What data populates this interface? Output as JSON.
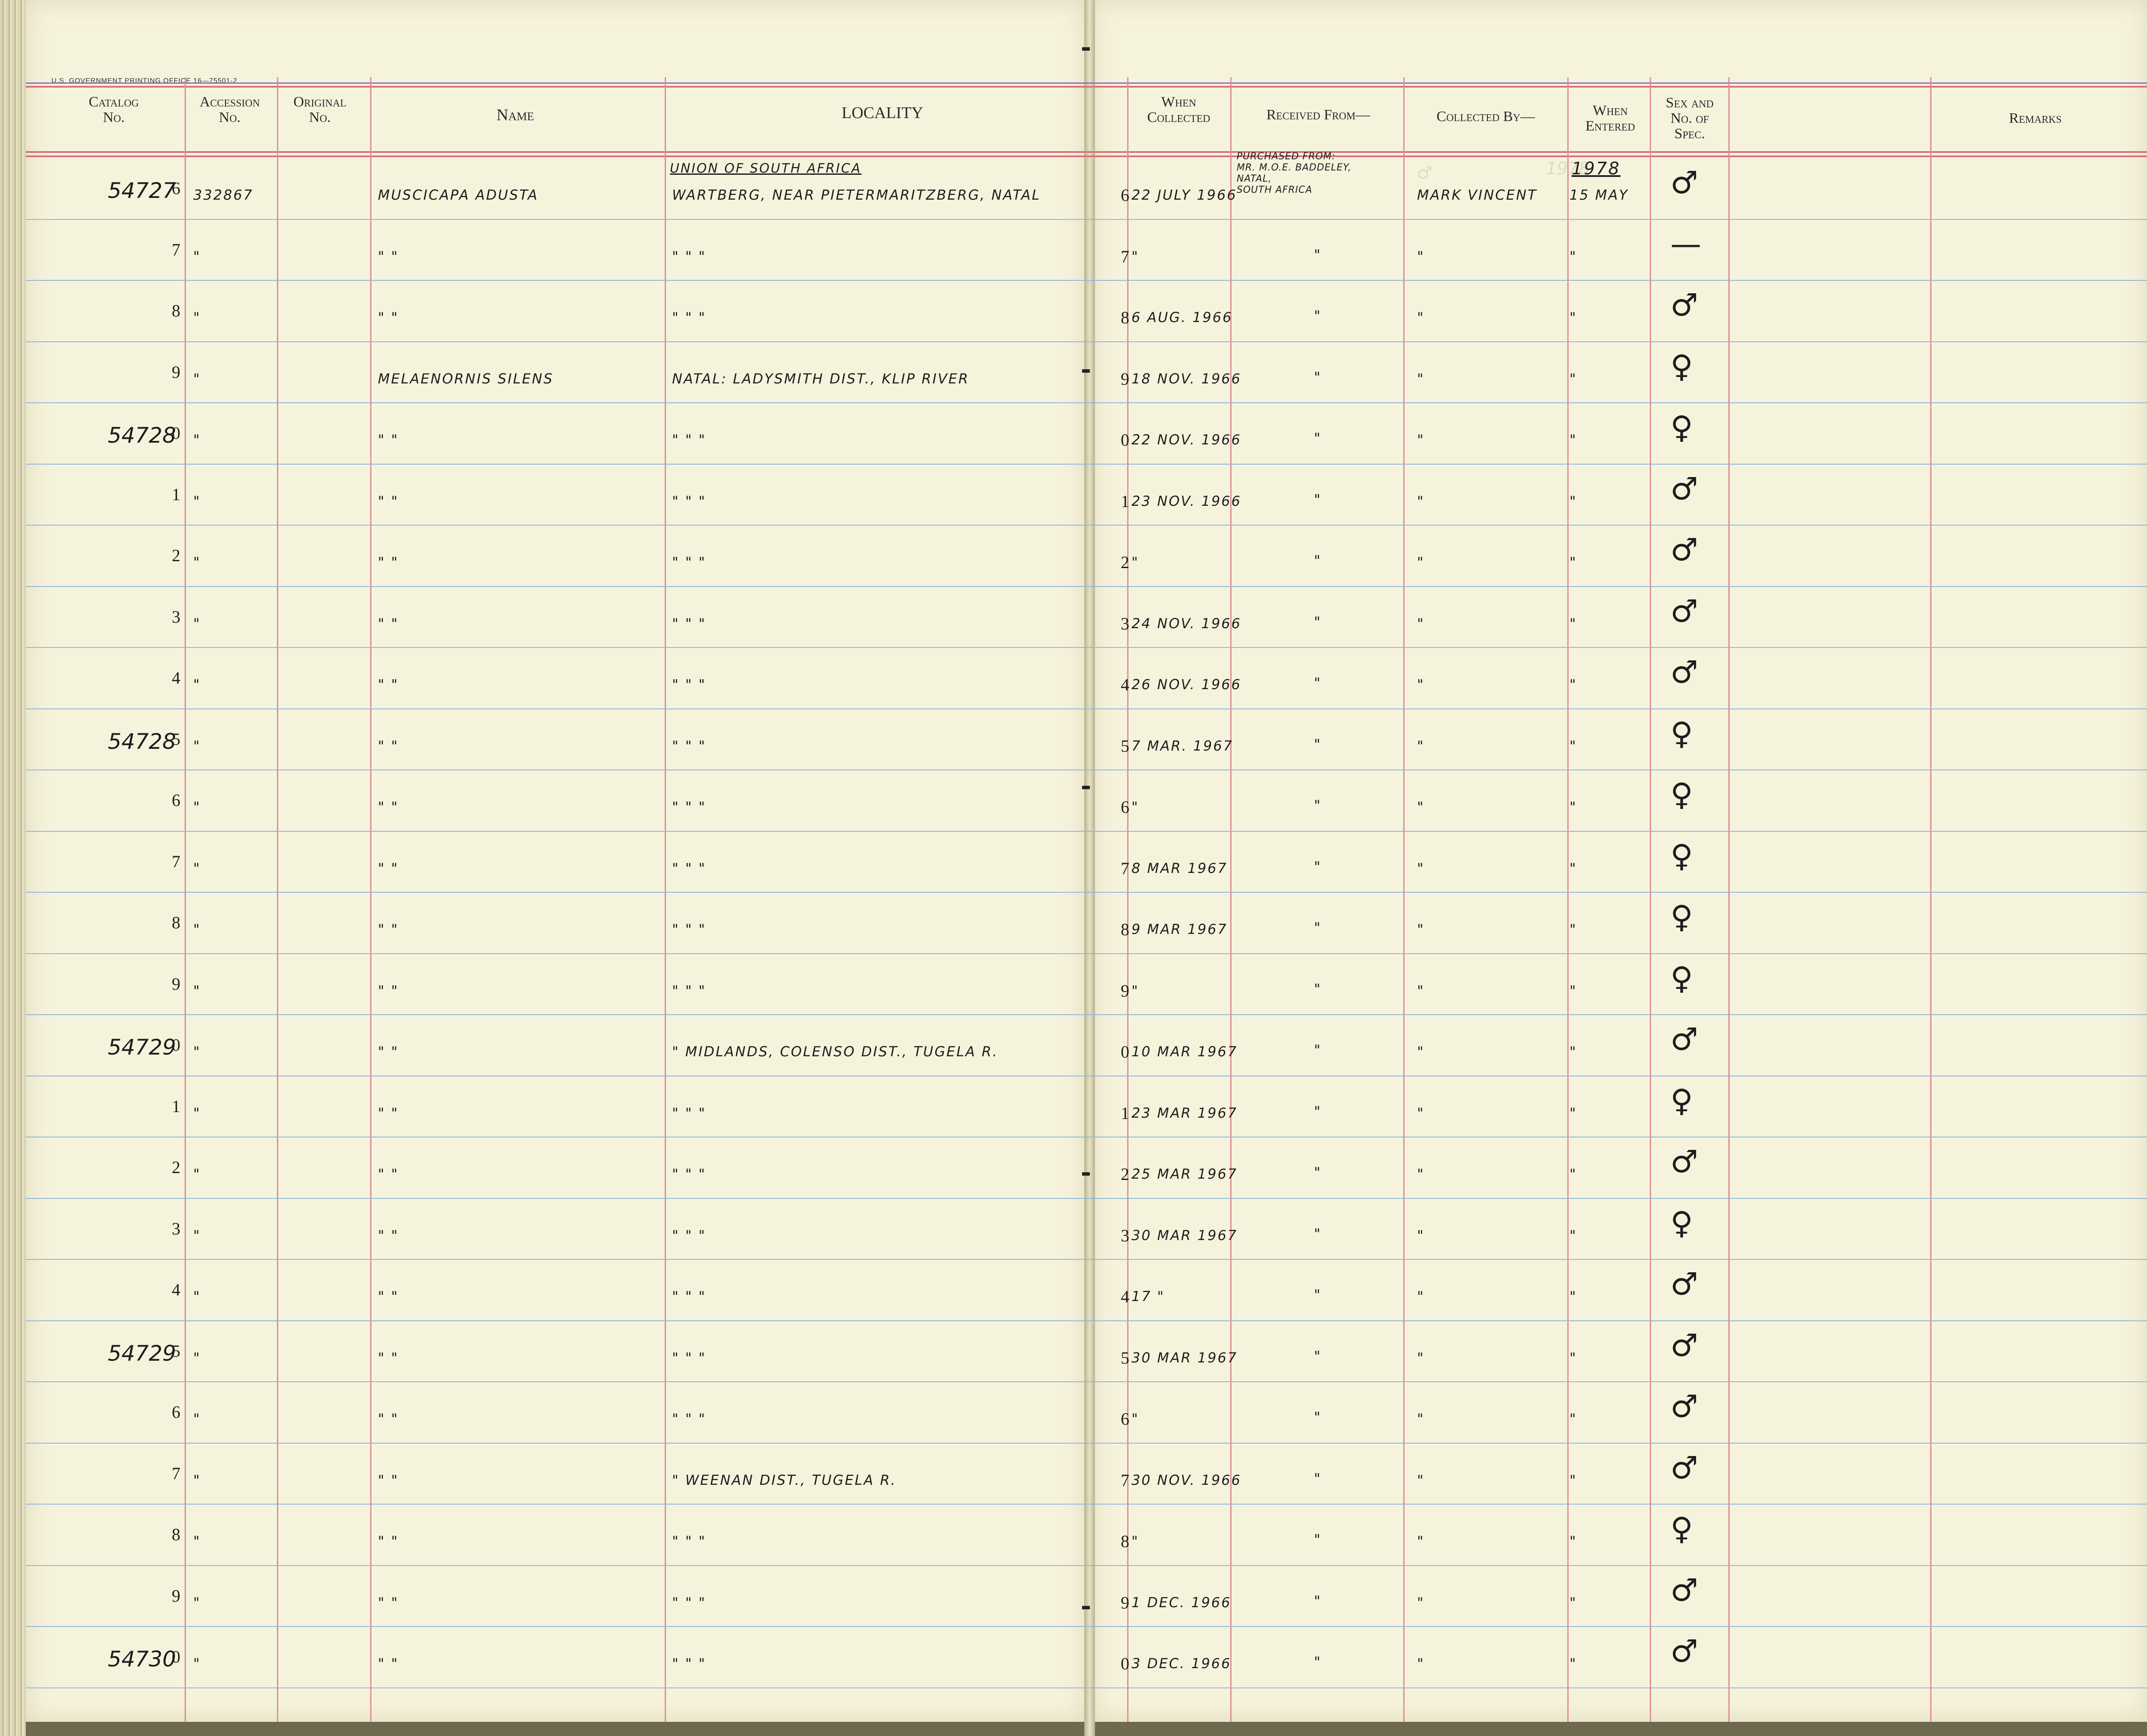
{
  "printer_line": "U.S. GOVERNMENT PRINTING OFFICE   16—75501-2",
  "headers": {
    "catalog": "Catalog\nNo.",
    "accession": "Accession\nNo.",
    "original": "Original\nNo.",
    "name": "Name",
    "locality": "LOCALITY",
    "when_collected": "When\nCollected",
    "received_from": "Received From—",
    "collected_by": "Collected By—",
    "when_entered": "When\nEntered",
    "sex": "Sex and\nNo. of\nSpec.",
    "remarks": "Remarks"
  },
  "header_notes": {
    "locality_heading": "UNION OF SOUTH AFRICA",
    "entered_year": "1978",
    "received_from_note": "PURCHASED FROM:\nMR. M.O.E. BADDELEY,\nNATAL,\nSOUTH AFRICA"
  },
  "rows": [
    {
      "catalog": "54727",
      "digit": "6",
      "accession": "332867",
      "name": "MUSCICAPA ADUSTA",
      "locality": "WARTBERG, NEAR PIETERMARITZBERG, NATAL",
      "cdigit": "6",
      "collected": "22 JULY 1966",
      "received": "",
      "collected_by": "MARK VINCENT",
      "entered": "15 MAY",
      "sex": "♂"
    },
    {
      "catalog": "",
      "digit": "7",
      "accession": "\"",
      "name": "\"          \"",
      "locality": "\"               \"               \"",
      "cdigit": "7",
      "collected": "\"",
      "received": "\"",
      "collected_by": "\"",
      "entered": "\"",
      "sex": "—"
    },
    {
      "catalog": "",
      "digit": "8",
      "accession": "\"",
      "name": "\"          \"",
      "locality": "\"               \"               \"",
      "cdigit": "8",
      "collected": "6 AUG. 1966",
      "received": "\"",
      "collected_by": "\"",
      "entered": "\"",
      "sex": "♂"
    },
    {
      "catalog": "",
      "digit": "9",
      "accession": "\"",
      "name": "MELAENORNIS SILENS",
      "locality": "NATAL: LADYSMITH DIST., KLIP RIVER",
      "cdigit": "9",
      "collected": "18 NOV. 1966",
      "received": "\"",
      "collected_by": "\"",
      "entered": "\"",
      "sex": "♀"
    },
    {
      "catalog": "54728",
      "digit": "0",
      "accession": "\"",
      "name": "\"          \"",
      "locality": "\"               \"               \"",
      "cdigit": "0",
      "collected": "22 NOV. 1966",
      "received": "\"",
      "collected_by": "\"",
      "entered": "\"",
      "sex": "♀"
    },
    {
      "catalog": "",
      "digit": "1",
      "accession": "\"",
      "name": "\"          \"",
      "locality": "\"               \"               \"",
      "cdigit": "1",
      "collected": "23 NOV. 1966",
      "received": "\"",
      "collected_by": "\"",
      "entered": "\"",
      "sex": "♂"
    },
    {
      "catalog": "",
      "digit": "2",
      "accession": "\"",
      "name": "\"          \"",
      "locality": "\"               \"               \"",
      "cdigit": "2",
      "collected": "\"",
      "received": "\"",
      "collected_by": "\"",
      "entered": "\"",
      "sex": "♂"
    },
    {
      "catalog": "",
      "digit": "3",
      "accession": "\"",
      "name": "\"          \"",
      "locality": "\"               \"               \"",
      "cdigit": "3",
      "collected": "24 NOV. 1966",
      "received": "\"",
      "collected_by": "\"",
      "entered": "\"",
      "sex": "♂"
    },
    {
      "catalog": "",
      "digit": "4",
      "accession": "\"",
      "name": "\"          \"",
      "locality": "\"               \"               \"",
      "cdigit": "4",
      "collected": "26 NOV. 1966",
      "received": "\"",
      "collected_by": "\"",
      "entered": "\"",
      "sex": "♂"
    },
    {
      "catalog": "54728",
      "digit": "5",
      "accession": "\"",
      "name": "\"          \"",
      "locality": "\"               \"               \"",
      "cdigit": "5",
      "collected": "7 MAR. 1967",
      "received": "\"",
      "collected_by": "\"",
      "entered": "\"",
      "sex": "♀"
    },
    {
      "catalog": "",
      "digit": "6",
      "accession": "\"",
      "name": "\"          \"",
      "locality": "\"               \"               \"",
      "cdigit": "6",
      "collected": "\"",
      "received": "\"",
      "collected_by": "\"",
      "entered": "\"",
      "sex": "♀"
    },
    {
      "catalog": "",
      "digit": "7",
      "accession": "\"",
      "name": "\"          \"",
      "locality": "\"               \"               \"",
      "cdigit": "7",
      "collected": "8 MAR 1967",
      "received": "\"",
      "collected_by": "\"",
      "entered": "\"",
      "sex": "♀"
    },
    {
      "catalog": "",
      "digit": "8",
      "accession": "\"",
      "name": "\"          \"",
      "locality": "\"               \"               \"",
      "cdigit": "8",
      "collected": "9 MAR 1967",
      "received": "\"",
      "collected_by": "\"",
      "entered": "\"",
      "sex": "♀"
    },
    {
      "catalog": "",
      "digit": "9",
      "accession": "\"",
      "name": "\"          \"",
      "locality": "\"               \"               \"",
      "cdigit": "9",
      "collected": "\"",
      "received": "\"",
      "collected_by": "\"",
      "entered": "\"",
      "sex": "♀"
    },
    {
      "catalog": "54729",
      "digit": "0",
      "accession": "\"",
      "name": "\"          \"",
      "locality": "\"   MIDLANDS, COLENSO DIST., TUGELA R.",
      "cdigit": "0",
      "collected": "10 MAR 1967",
      "received": "\"",
      "collected_by": "\"",
      "entered": "\"",
      "sex": "♂"
    },
    {
      "catalog": "",
      "digit": "1",
      "accession": "\"",
      "name": "\"          \"",
      "locality": "\"               \"               \"",
      "cdigit": "1",
      "collected": "23 MAR 1967",
      "received": "\"",
      "collected_by": "\"",
      "entered": "\"",
      "sex": "♀"
    },
    {
      "catalog": "",
      "digit": "2",
      "accession": "\"",
      "name": "\"          \"",
      "locality": "\"               \"               \"",
      "cdigit": "2",
      "collected": "25 MAR 1967",
      "received": "\"",
      "collected_by": "\"",
      "entered": "\"",
      "sex": "♂"
    },
    {
      "catalog": "",
      "digit": "3",
      "accession": "\"",
      "name": "\"          \"",
      "locality": "\"               \"               \"",
      "cdigit": "3",
      "collected": "30 MAR 1967",
      "received": "\"",
      "collected_by": "\"",
      "entered": "\"",
      "sex": "♀"
    },
    {
      "catalog": "",
      "digit": "4",
      "accession": "\"",
      "name": "\"          \"",
      "locality": "\"               \"               \"",
      "cdigit": "4",
      "collected": "17   \"",
      "received": "\"",
      "collected_by": "\"",
      "entered": "\"",
      "sex": "♂"
    },
    {
      "catalog": "54729",
      "digit": "5",
      "accession": "\"",
      "name": "\"          \"",
      "locality": "\"               \"               \"",
      "cdigit": "5",
      "collected": "30 MAR 1967",
      "received": "\"",
      "collected_by": "\"",
      "entered": "\"",
      "sex": "♂"
    },
    {
      "catalog": "",
      "digit": "6",
      "accession": "\"",
      "name": "\"          \"",
      "locality": "\"               \"               \"",
      "cdigit": "6",
      "collected": "\"",
      "received": "\"",
      "collected_by": "\"",
      "entered": "\"",
      "sex": "♂"
    },
    {
      "catalog": "",
      "digit": "7",
      "accession": "\"",
      "name": "\"          \"",
      "locality": "\"   WEENAN DIST., TUGELA R.",
      "cdigit": "7",
      "collected": "30 NOV. 1966",
      "received": "\"",
      "collected_by": "\"",
      "entered": "\"",
      "sex": "♂"
    },
    {
      "catalog": "",
      "digit": "8",
      "accession": "\"",
      "name": "\"          \"",
      "locality": "\"               \"               \"",
      "cdigit": "8",
      "collected": "\"",
      "received": "\"",
      "collected_by": "\"",
      "entered": "\"",
      "sex": "♀"
    },
    {
      "catalog": "",
      "digit": "9",
      "accession": "\"",
      "name": "\"          \"",
      "locality": "\"               \"               \"",
      "cdigit": "9",
      "collected": "1 DEC. 1966",
      "received": "\"",
      "collected_by": "\"",
      "entered": "\"",
      "sex": "♂"
    },
    {
      "catalog": "54730",
      "digit": "0",
      "accession": "\"",
      "name": "\"          \"",
      "locality": "\"               \"               \"",
      "cdigit": "0",
      "collected": "3 DEC. 1966",
      "received": "\"",
      "collected_by": "\"",
      "entered": "\"",
      "sex": "♂"
    }
  ]
}
